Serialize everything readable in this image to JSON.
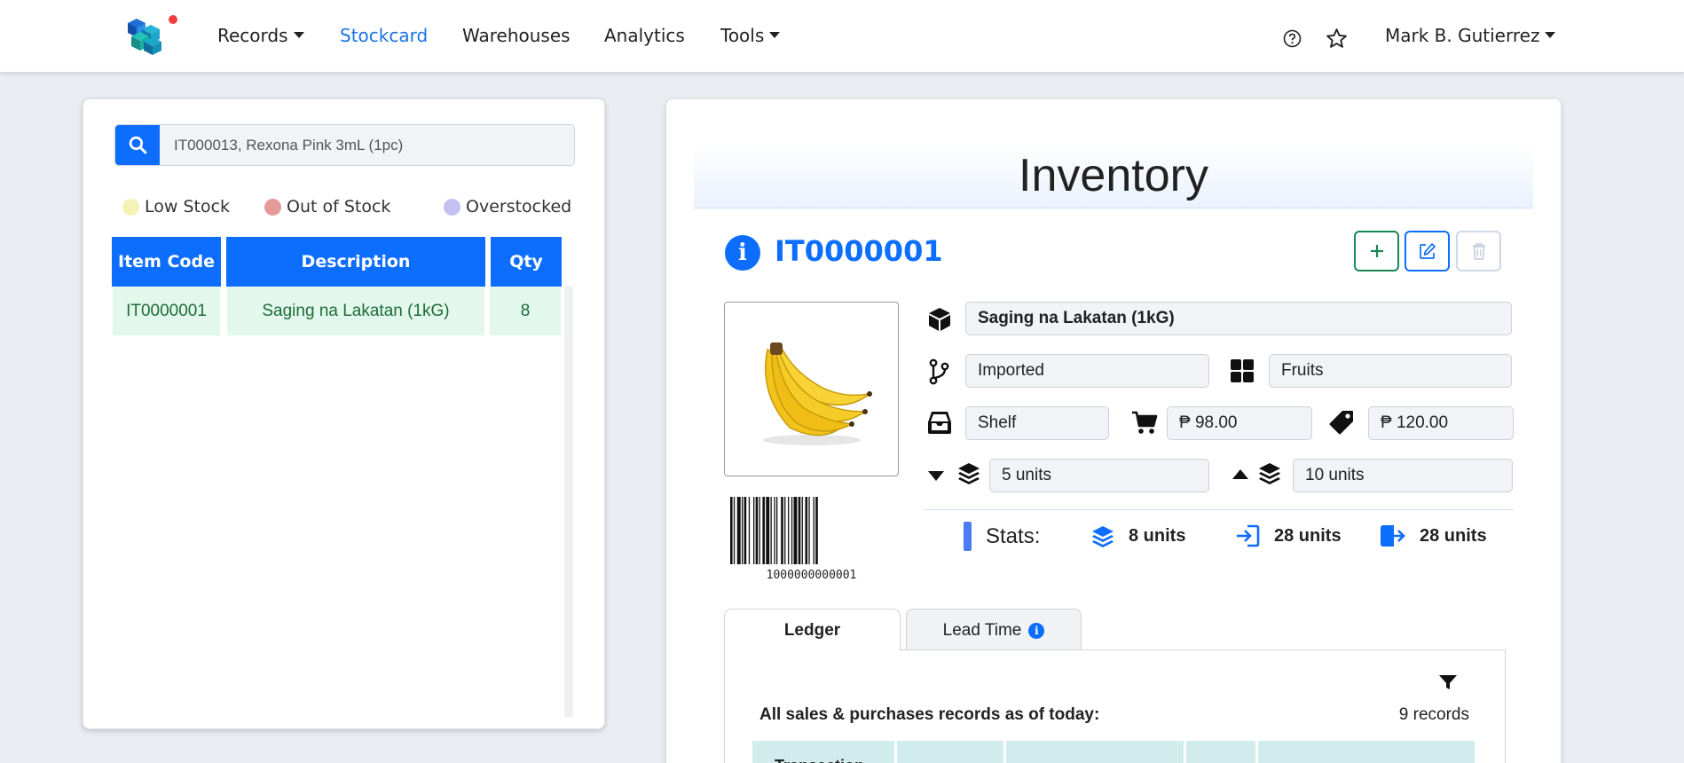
{
  "navbar": {
    "menu": [
      {
        "label": "Records",
        "dropdown": true,
        "active": false
      },
      {
        "label": "Stockcard",
        "dropdown": false,
        "active": true
      },
      {
        "label": "Warehouses",
        "dropdown": false,
        "active": false
      },
      {
        "label": "Analytics",
        "dropdown": false,
        "active": false
      },
      {
        "label": "Tools",
        "dropdown": true,
        "active": false
      }
    ],
    "icons": [
      "help-icon",
      "star-icon"
    ],
    "user_name": "Mark B. Gutierrez"
  },
  "search": {
    "placeholder": "IT000013, Rexona Pink 3mL (1pc)",
    "icon": "search-icon"
  },
  "legend": [
    {
      "label": "Low Stock",
      "color": "#f5f2b8"
    },
    {
      "label": "Out of Stock",
      "color": "#e59a9a"
    },
    {
      "label": "Overstocked",
      "color": "#c4c0f2"
    }
  ],
  "item_table": {
    "headers": [
      "Item Code",
      "Description",
      "Qty"
    ],
    "rows": [
      [
        "IT0000001",
        "Saging na Lakatan (1kG)",
        "8"
      ]
    ]
  },
  "inventory": {
    "title": "Inventory",
    "item_code": "IT0000001",
    "barcode_number": "1000000000001",
    "description": "Saging na Lakatan (1kG)",
    "origin": "Imported",
    "category": "Fruits",
    "location": "Shelf",
    "purchase_price": "₱ 98.00",
    "selling_price": "₱ 120.00",
    "min_stock": "5 units",
    "max_stock": "10 units",
    "stats": {
      "label": "Stats:",
      "on_hand": "8 units",
      "stock_in": "28 units",
      "stock_out": "28 units"
    },
    "actions": [
      "add-button",
      "edit-button",
      "delete-button"
    ]
  },
  "tabs": [
    {
      "label": "Ledger",
      "active": true
    },
    {
      "label": "Lead Time",
      "active": false
    }
  ],
  "ledger": {
    "caption": "All sales & purchases records as of today:",
    "count": "9 records",
    "first_header": "Transaction"
  },
  "colors": {
    "primary": "#0d6efd",
    "success": "#198754",
    "row_bg": "#e3f8ec",
    "ledger_header_bg": "#d0ecec"
  }
}
